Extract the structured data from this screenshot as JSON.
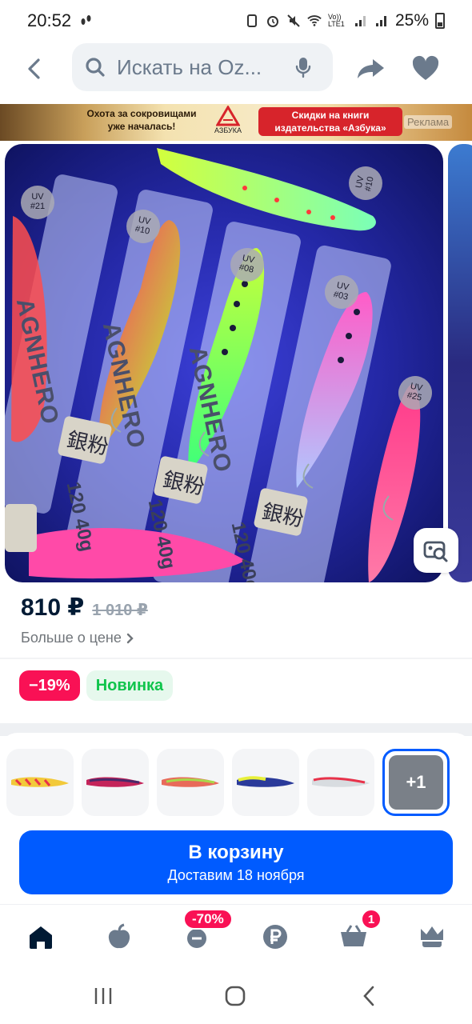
{
  "status_bar": {
    "time": "20:52",
    "network": "Vo)) LTE1",
    "battery": "25%"
  },
  "top_bar": {
    "search_placeholder": "Искать на Oz..."
  },
  "banner": {
    "left_text_line1": "Охота за сокровищами",
    "left_text_line2": "уже началась!",
    "logo_text": "АЗБУКА",
    "right_text_line1": "Скидки на книги",
    "right_text_line2": "издательства «Азбука»",
    "ad_label": "Реклама"
  },
  "gallery": {
    "labels": [
      {
        "code": "UV\n#21"
      },
      {
        "code": "UV\n#10"
      },
      {
        "code": "UV\n#08"
      },
      {
        "code": "UV\n#03"
      },
      {
        "code": "UV\n#25"
      },
      {
        "code": "UV\n#10"
      }
    ],
    "brand_text": "AGNHERO",
    "size_text": "120 40g",
    "stamp_text": "銀粉"
  },
  "price": {
    "current": "810 ₽",
    "old": "1 010 ₽",
    "more_link": "Больше о цене"
  },
  "badges": {
    "discount": "−19%",
    "new": "Новинка"
  },
  "variants": {
    "more_label": "+1"
  },
  "cart_button": {
    "label": "В корзину",
    "delivery": "Доставим 18 ноября"
  },
  "bottom_nav": {
    "promo_badge": "-70%",
    "cart_count": "1"
  },
  "colors": {
    "accent": "#005bff",
    "discount": "#f91155",
    "new_green": "#10c44c"
  }
}
